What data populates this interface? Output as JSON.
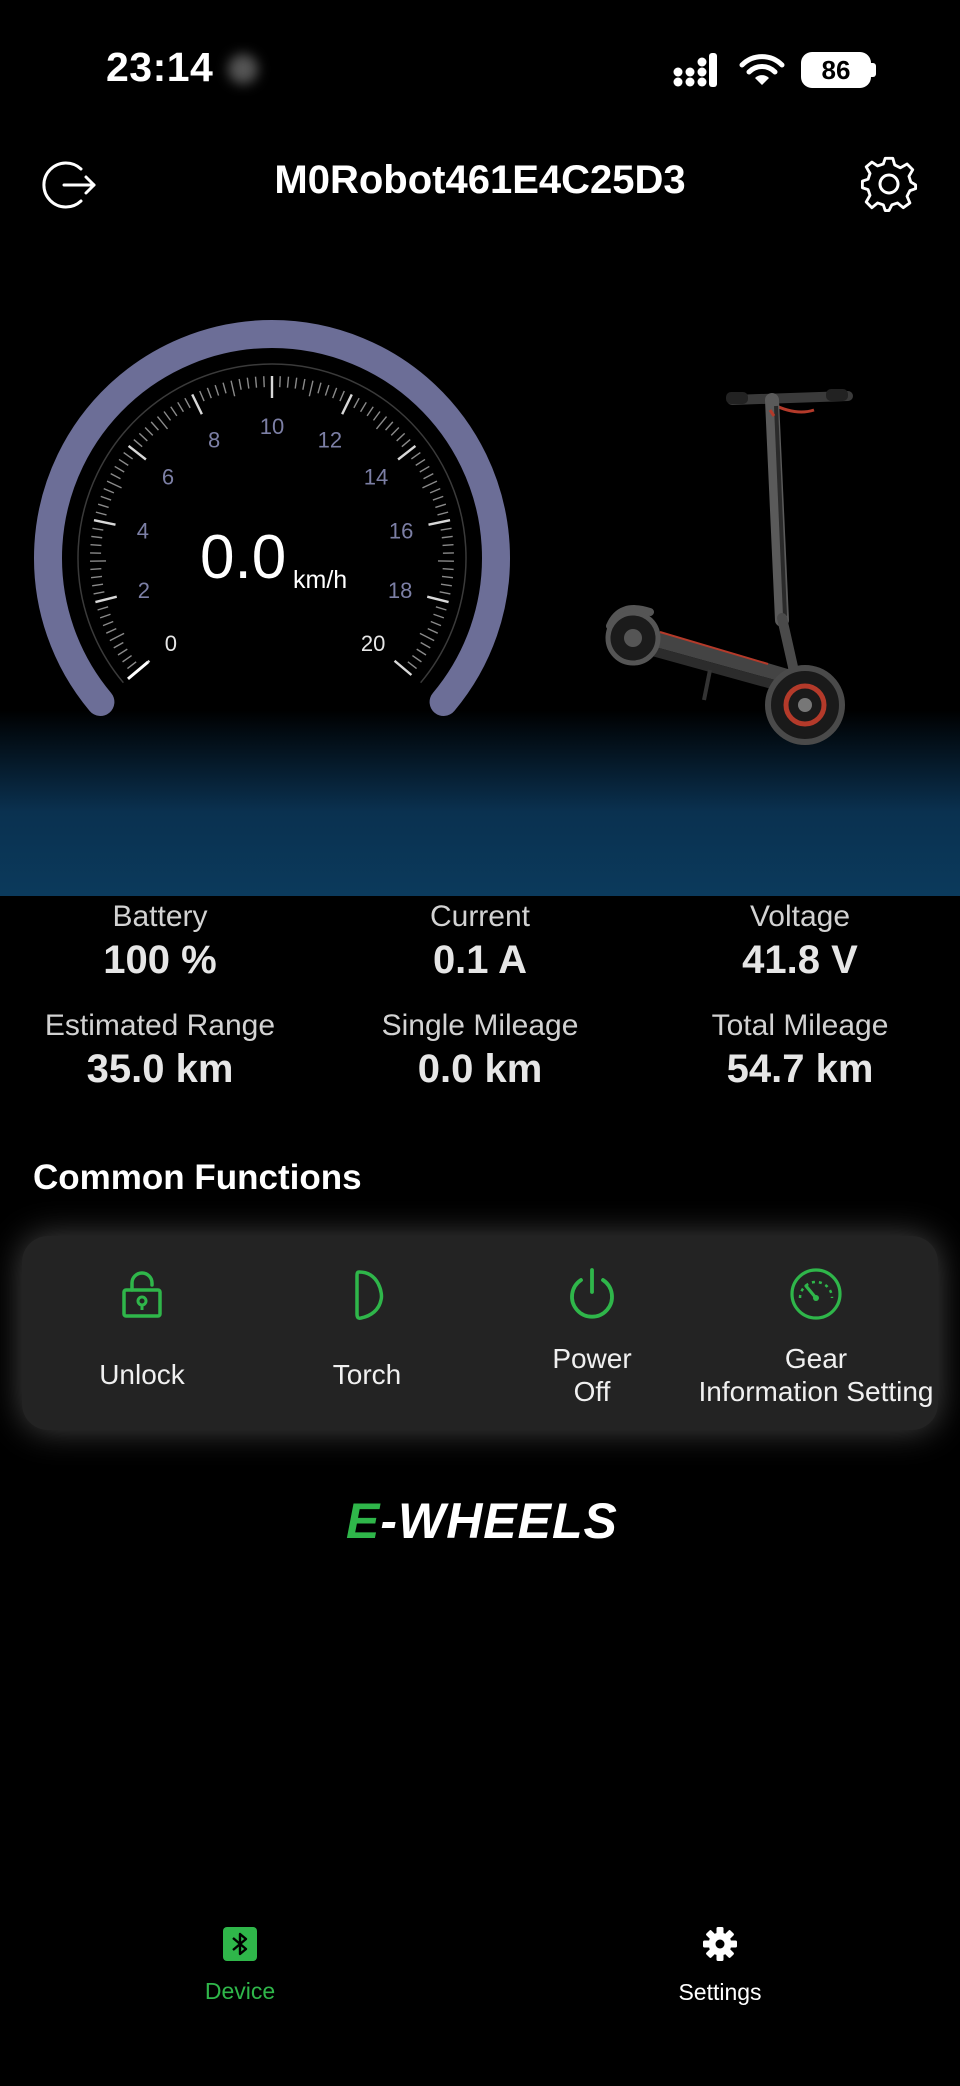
{
  "status_bar": {
    "time": "23:14",
    "battery_level": "86",
    "icons": [
      "cellular-signal-icon",
      "wifi-icon",
      "battery-icon"
    ]
  },
  "header": {
    "title": "M0Robot461E4C25D3",
    "left_icon": "logout-icon",
    "right_icon": "gear-icon"
  },
  "speedometer": {
    "speed": "0.0",
    "unit": "km/h",
    "ticks": [
      "0",
      "2",
      "4",
      "6",
      "8",
      "10",
      "12",
      "14",
      "16",
      "18",
      "20"
    ],
    "min": 0,
    "max": 20,
    "current_value": 0.0,
    "arc_color": "#6c6e97"
  },
  "stats": [
    {
      "label": "Battery",
      "value": "100 %"
    },
    {
      "label": "Current",
      "value": "0.1 A"
    },
    {
      "label": "Voltage",
      "value": "41.8 V"
    },
    {
      "label": "Estimated Range",
      "value": "35.0 km"
    },
    {
      "label": "Single Mileage",
      "value": "0.0 km"
    },
    {
      "label": "Total Mileage",
      "value": "54.7 km"
    }
  ],
  "common_functions": {
    "title": "Common Functions",
    "items": [
      {
        "label": "Unlock",
        "icon": "lock-icon"
      },
      {
        "label": "Torch",
        "icon": "torch-icon"
      },
      {
        "label_line1": "Power",
        "label_line2": "Off",
        "icon": "power-icon"
      },
      {
        "label_line1": "Gear",
        "label_line2": "Information Setting",
        "icon": "gauge-icon"
      }
    ],
    "accent_color": "#2fb64a"
  },
  "brand": {
    "logo_accent": "E",
    "logo_rest": "-WHEELS"
  },
  "tab_bar": {
    "items": [
      {
        "label": "Device",
        "icon": "bluetooth-icon",
        "active": true
      },
      {
        "label": "Settings",
        "icon": "settings-icon",
        "active": false
      }
    ],
    "active_color": "#2fb64a",
    "inactive_color": "#ffffff"
  }
}
